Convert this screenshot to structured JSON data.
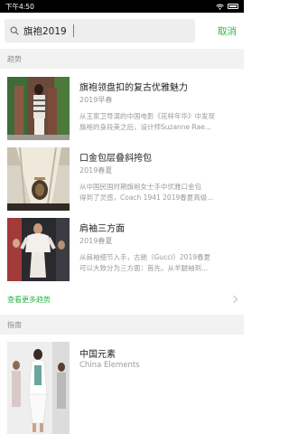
{
  "status_bar": {
    "time": "下午4:50"
  },
  "search": {
    "query": "旗袍2019",
    "cancel_label": "取消"
  },
  "trends": {
    "header": "趋势",
    "items": [
      {
        "title": "旗袍领盘扣的复古优雅魅力",
        "date": "2019早春",
        "desc_line1": "从王家卫导演的中国电影《花样年华》中发现",
        "desc_line2": "旗袍的身段美之后，设计师Suzanne Rae..."
      },
      {
        "title": "口金包层叠斜挎包",
        "date": "2019春夏",
        "desc_line1": "从中国民国时期旗袍女士手中优雅口金包",
        "desc_line2": "得到了灵感，Coach 1941 2019春夏高级..."
      },
      {
        "title": "肩袖三方面",
        "date": "2019春夏",
        "desc_line1": "从肩袖细节入手，古驰（Gucci）2019春夏",
        "desc_line2": "可以大致分为三方面：首先，从羊腿袖到..."
      }
    ],
    "more_label": "查看更多趋势"
  },
  "guide": {
    "header": "指南",
    "item": {
      "title": "中国元素",
      "subtitle": "China Elements"
    }
  }
}
